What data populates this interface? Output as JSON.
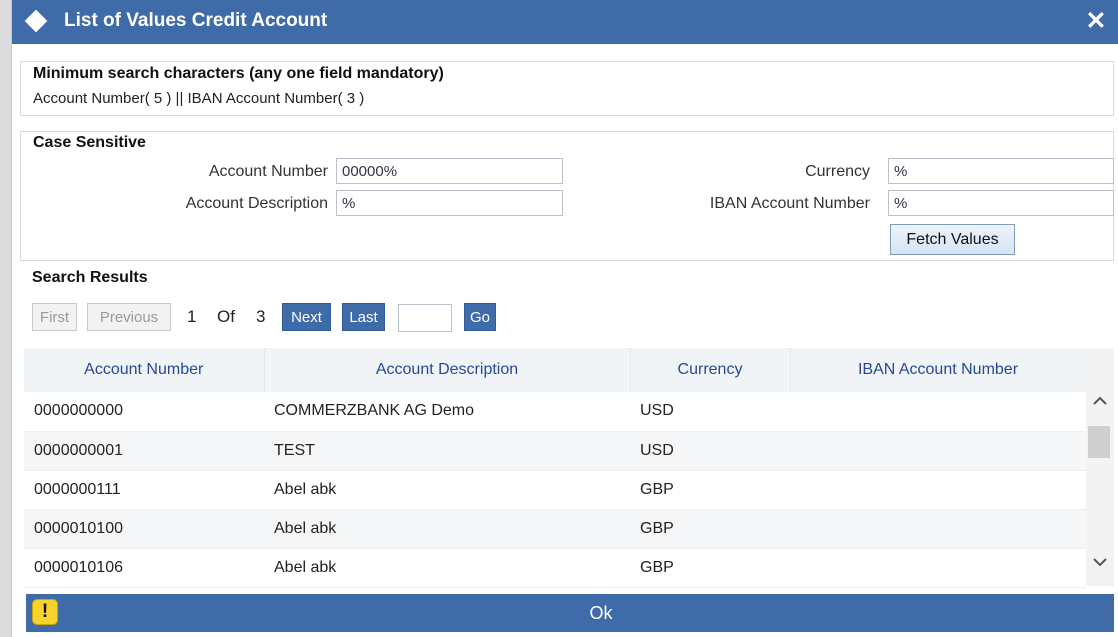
{
  "window": {
    "title": "List of Values Credit Account",
    "close_symbol": "✕",
    "title_icon": "diamond-icon"
  },
  "min_search": {
    "legend": "Minimum search characters (any one field mandatory)",
    "text": "Account Number( 5 ) || IBAN Account Number( 3 )"
  },
  "case_sensitive": {
    "legend": "Case Sensitive",
    "account_number_label": "Account Number",
    "account_number_value": "00000%",
    "account_description_label": "Account Description",
    "account_description_value": "%",
    "currency_label": "Currency",
    "currency_value": "%",
    "iban_label": "IBAN Account Number",
    "iban_value": "%",
    "fetch_label": "Fetch Values"
  },
  "search_results": {
    "title": "Search Results",
    "pager": {
      "first": "First",
      "previous": "Previous",
      "current": "1",
      "of": "Of",
      "total": "3",
      "next": "Next",
      "last": "Last",
      "go": "Go",
      "page_input": ""
    },
    "columns": [
      "Account Number",
      "Account Description",
      "Currency",
      "IBAN Account Number"
    ],
    "rows": [
      [
        "0000000000",
        "COMMERZBANK AG Demo",
        "USD",
        ""
      ],
      [
        "0000000001",
        "TEST",
        "USD",
        ""
      ],
      [
        "0000000111",
        "Abel abk",
        "GBP",
        ""
      ],
      [
        "0000010100",
        "Abel abk",
        "GBP",
        ""
      ],
      [
        "0000010106",
        "Abel abk",
        "GBP",
        ""
      ]
    ]
  },
  "footer": {
    "warning_symbol": "!",
    "ok_label": "Ok"
  },
  "colors": {
    "header_blue": "#3f6ba8",
    "column_header_text": "#27489a",
    "warning_yellow": "#f7d32b"
  }
}
